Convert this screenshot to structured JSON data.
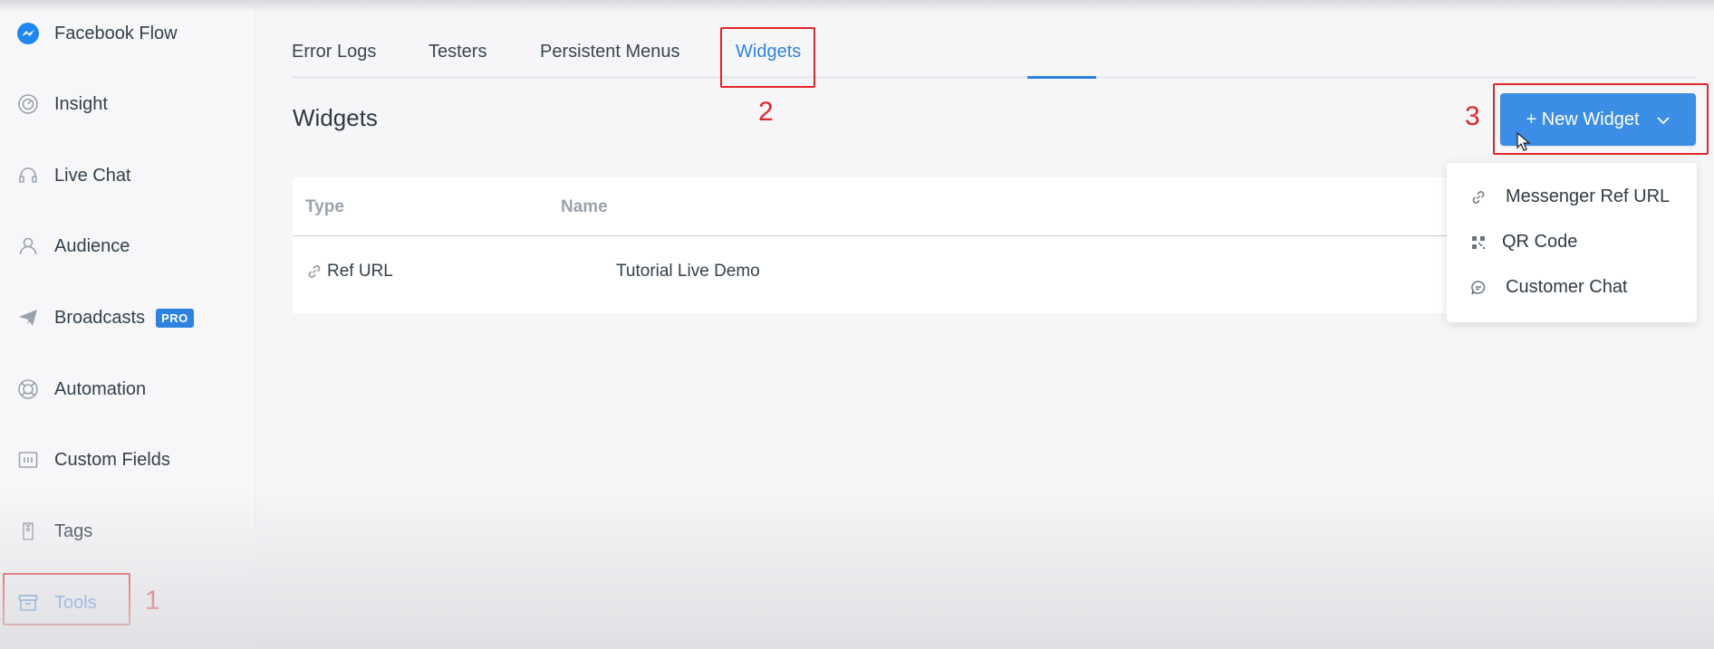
{
  "sidebar": {
    "items": [
      {
        "label": "Facebook Flow",
        "icon": "messenger-icon"
      },
      {
        "label": "Insight",
        "icon": "gauge-icon"
      },
      {
        "label": "Live Chat",
        "icon": "headset-icon"
      },
      {
        "label": "Audience",
        "icon": "user-icon"
      },
      {
        "label": "Broadcasts",
        "icon": "paper-plane-icon",
        "badge": "PRO"
      },
      {
        "label": "Automation",
        "icon": "lifebuoy-icon"
      },
      {
        "label": "Custom Fields",
        "icon": "fields-icon"
      },
      {
        "label": "Tags",
        "icon": "tag-icon"
      },
      {
        "label": "Tools",
        "icon": "toolbox-icon",
        "active": true
      }
    ]
  },
  "tabs": [
    {
      "label": "Error Logs"
    },
    {
      "label": "Testers"
    },
    {
      "label": "Persistent Menus"
    },
    {
      "label": "Widgets",
      "active": true
    }
  ],
  "page": {
    "title": "Widgets"
  },
  "new_widget": {
    "label": "+ New Widget"
  },
  "table": {
    "columns": [
      "Type",
      "Name"
    ],
    "rows": [
      {
        "type": "Ref URL",
        "name": "Tutorial Live Demo"
      }
    ]
  },
  "dropdown": {
    "items": [
      {
        "label": "Messenger Ref URL",
        "icon": "link-icon"
      },
      {
        "label": "QR Code",
        "icon": "qr-code-icon"
      },
      {
        "label": "Customer Chat",
        "icon": "chat-bubble-icon"
      }
    ]
  },
  "annotations": [
    "1",
    "2",
    "3"
  ],
  "colors": {
    "accent": "#2d83e0",
    "annotation": "#e0262a",
    "button": "#3b8de6"
  }
}
